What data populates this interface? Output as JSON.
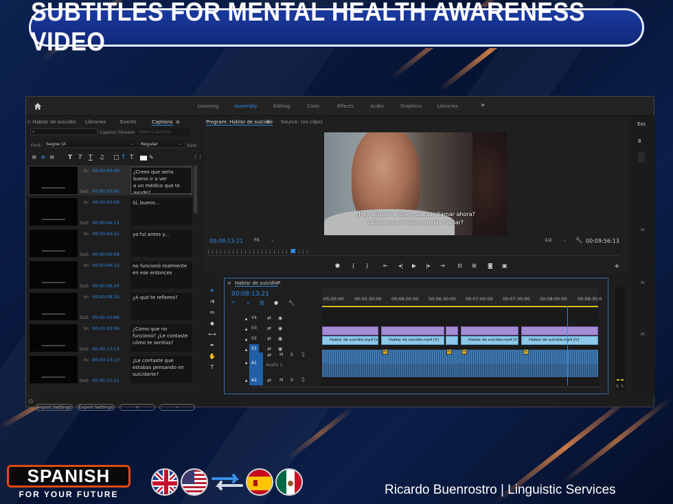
{
  "banner": {
    "title": "SUBTITLES FOR MENTAL HEALTH AWARENESS VIDEO"
  },
  "app": {
    "workspaces": [
      "Learning",
      "Assembly",
      "Editing",
      "Color",
      "Effects",
      "Audio",
      "Graphics",
      "Libraries"
    ],
    "active_workspace": "Assembly",
    "left_tabs": [
      "r: Hablar de suicidio",
      "Libraries",
      "Events",
      "Captions"
    ],
    "caption_stream_label": "Caption Stream:",
    "caption_stream_placeholder": "Open Captions",
    "font_label": "Font:",
    "font_value": "Segoe UI",
    "style_value": "Regular",
    "size_label": "Size:",
    "in_label": "In:",
    "out_label": "Out:",
    "captions": [
      {
        "in": "00:00:00:00",
        "out": "00:00:03:00",
        "text": "¿Crees que sería bueno ir a ver\na un médico que te ayude?"
      },
      {
        "in": "00:00:03:06",
        "out": "00:00:04:13",
        "text": "Sí, bueno..."
      },
      {
        "in": "00:00:04:21",
        "out": "00:00:06:09",
        "text": "ya fui antes y..."
      },
      {
        "in": "00:00:06:22",
        "out": "00:00:08:20",
        "text": "no funcionó realmente en ese entonces"
      },
      {
        "in": "00:00:08:20",
        "out": "00:00:10:06",
        "text": "¿A qué te refieres?"
      },
      {
        "in": "00:00:10:06",
        "out": "00:00:13:13",
        "text": "¿Cómo que no funcionó? ¿Le contaste cómo te sentías?"
      },
      {
        "in": "00:00:13:13",
        "out": "00:00:15:21",
        "text": "¿Le contaste que estabas pensando en suicidarte?"
      }
    ],
    "import_settings": "Import Settings",
    "export_settings": "Export Settings",
    "plus": "+",
    "minus": "−",
    "program_tab": "Program: Hablar de suicidio",
    "source_tab": "Source: (no clips)",
    "subtitle_line1": "¿Hay alguien a quien puedas llamar ahora?",
    "subtitle_line2": "¿Alguien con quien puedas hablar?",
    "program_timecode": "00:08:13:21",
    "fit_value": "Fit",
    "resolution_value": "1/2",
    "duration": "00:09:56:13",
    "sequence_tab": "Hablar de suicidio",
    "timeline_timecode": "00:08:13:21",
    "ruler_ticks": [
      ":05:00:00",
      "00:05:30:00",
      "00:06:00:00",
      "00:06:30:00",
      "00:07:00:00",
      "00:07:30:00",
      "00:08:00:00",
      "00:08:30:0"
    ],
    "tracks": [
      "V4",
      "V3",
      "V2",
      "V1",
      "A1",
      "A2"
    ],
    "audio_track_name": "Audio 1",
    "clip_name": "Hablar de suicidio.mp4 [V]",
    "right_tab": "Ess",
    "right_letter": "B",
    "meter_labels": [
      "S",
      "S"
    ],
    "side_labels": [
      "Ar",
      "Ar",
      "Ar"
    ]
  },
  "footer": {
    "logo_main": "SPANISH",
    "logo_sub": "FOR YOUR FUTURE",
    "credit": "Ricardo Buenrostro | Linguistic Services"
  },
  "colors": {
    "accent": "#2d8ceb",
    "banner_bg": "#1b3aa0",
    "logo_orange": "#e04a12"
  }
}
